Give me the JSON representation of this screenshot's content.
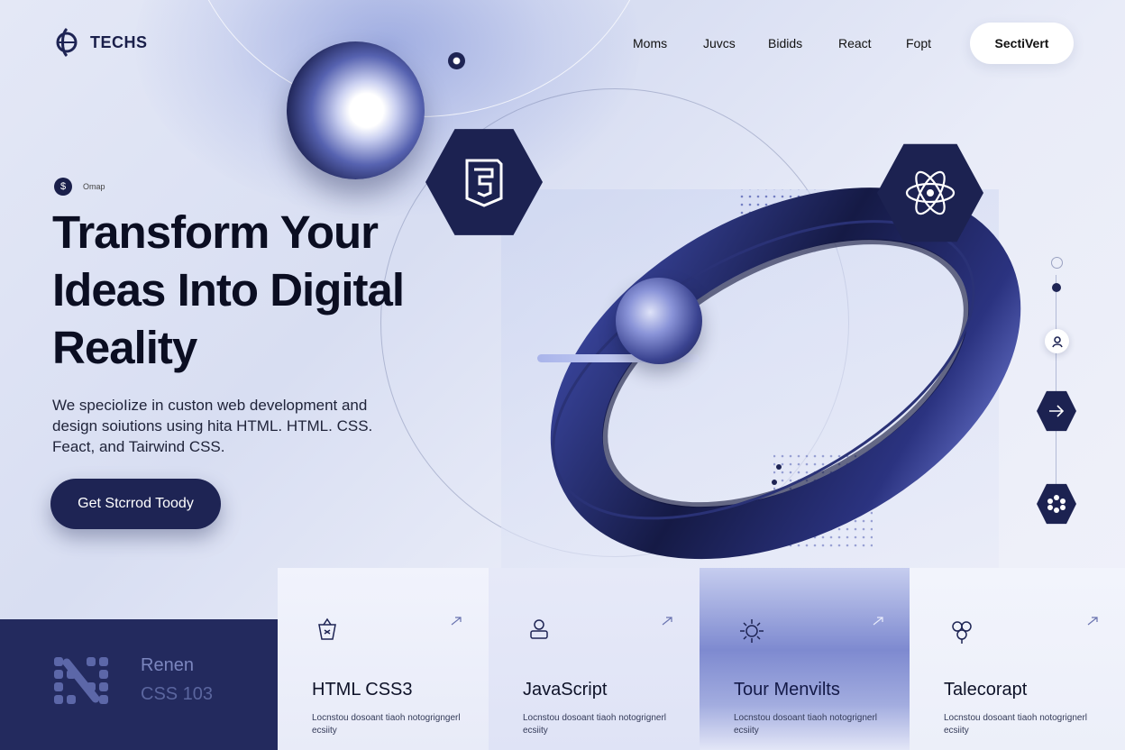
{
  "brand": {
    "name": "TECHS"
  },
  "nav": {
    "items": [
      "Moms",
      "Juvcs",
      "Bidids",
      "React",
      "Fopt"
    ],
    "cta_label": "SectiVert"
  },
  "hero": {
    "badge_icon": "$",
    "badge_text": "Omap",
    "title": "Transform Your Ideas Into Digital Reality",
    "description": "We specioIize in custon web development and design soiutions using hita HTML. HTML. CSS. Feact, and Tairwind CSS.",
    "cta_label": "Get Stcrrod Toody"
  },
  "bottom_panel": {
    "line1": "Renen",
    "line2": "CSS 103"
  },
  "cards": [
    {
      "icon": "tag-icon",
      "title": "HTML CSS3",
      "desc": "Locnstou dosoant tiaoh notogrigngerl ecsiity"
    },
    {
      "icon": "user-laptop-icon",
      "title": "JavaScript",
      "desc": "Locnstou dosoant tiaoh notogrignerl ecsiity"
    },
    {
      "icon": "gear-icon",
      "title": "Tour Menvilts",
      "desc": "Locnstou dosoant tiaoh notogrignerl ecsiity"
    },
    {
      "icon": "cluster-icon",
      "title": "Talecorapt",
      "desc": "Locnstou dosoant tiaoh notogrignerl ecsiity"
    }
  ],
  "colors": {
    "primary": "#1e2454",
    "accent": "#5c67c4",
    "background": "#e4e8f6"
  }
}
